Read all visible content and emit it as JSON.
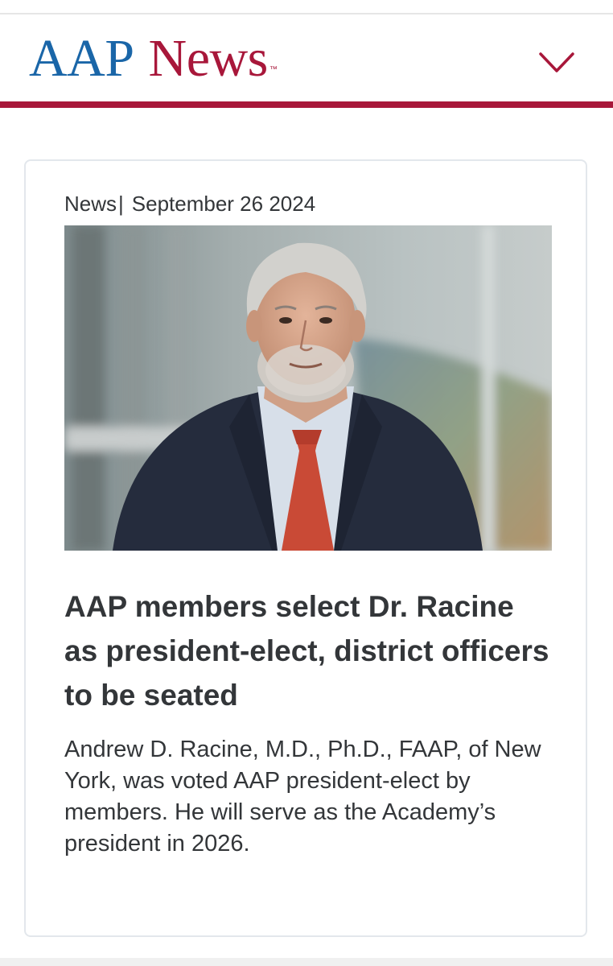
{
  "header": {
    "logo_aap": "AAP",
    "logo_news": "News",
    "logo_tm": "™",
    "menu_icon": "chevron-down-icon"
  },
  "colors": {
    "brand_blue": "#1a66a8",
    "brand_red": "#a8173a",
    "text": "#333639",
    "card_border": "#e3e7ec"
  },
  "article": {
    "category": "News",
    "separator": "|",
    "date": "September 26 2024",
    "photo": "portrait of a smiling gray-haired man in a navy suit and red tie",
    "headline": "AAP members select Dr. Racine as president-elect, district officers to be seated",
    "summary": "Andrew D. Racine, M.D., Ph.D., FAAP, of New York, was voted AAP president-elect by members. He will serve as the Academy’s president in 2026."
  }
}
